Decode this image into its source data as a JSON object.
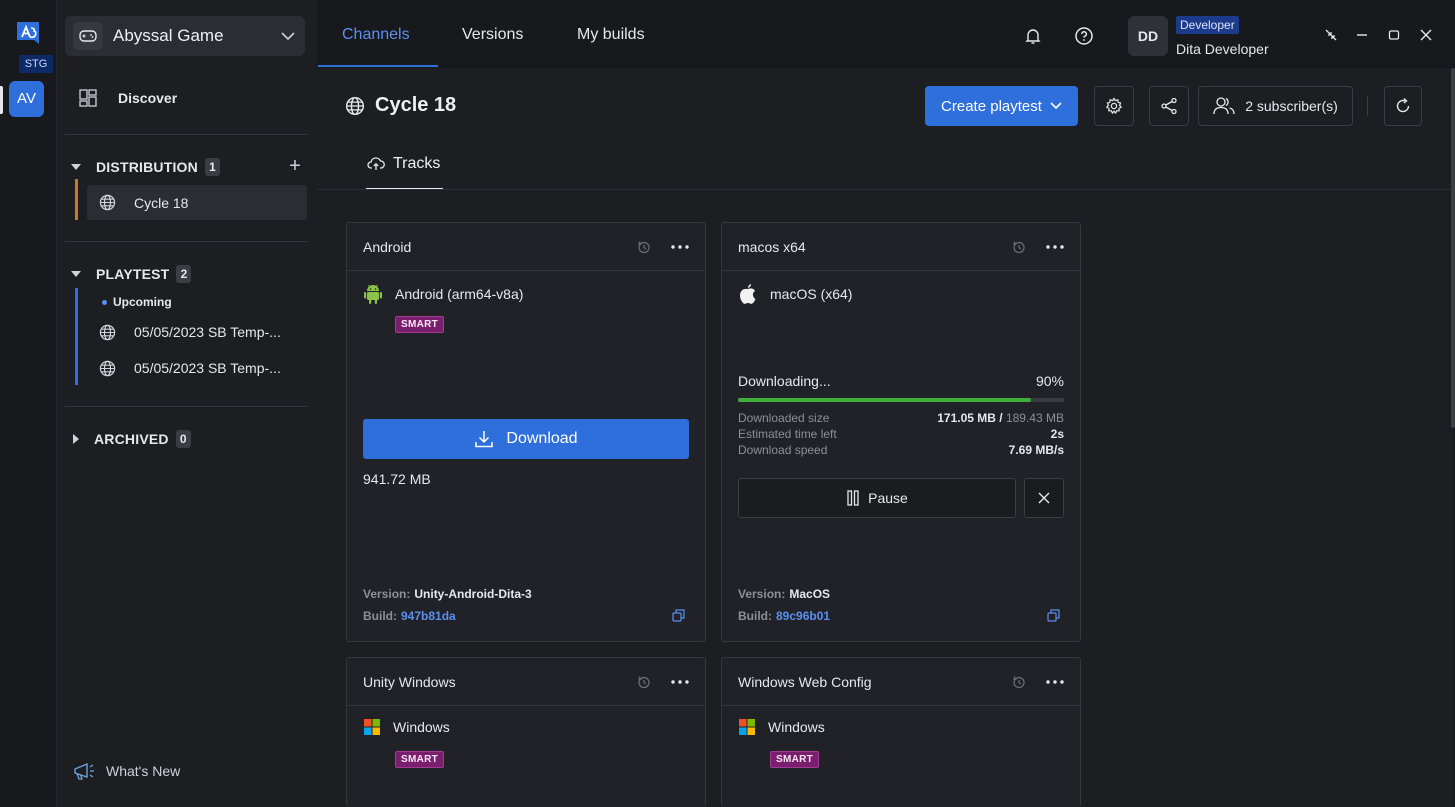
{
  "rail": {
    "env_badge": "STG",
    "avatar_initials": "AV"
  },
  "sidebar": {
    "game_name": "Abyssal Game",
    "discover_label": "Discover",
    "distribution": {
      "label": "DISTRIBUTION",
      "count": "1",
      "items": [
        {
          "label": "Cycle 18"
        }
      ]
    },
    "playtest": {
      "label": "PLAYTEST",
      "count": "2",
      "group_label": "Upcoming",
      "items": [
        {
          "label": "05/05/2023 SB Temp-..."
        },
        {
          "label": "05/05/2023 SB Temp-..."
        }
      ]
    },
    "archived": {
      "label": "ARCHIVED",
      "count": "0"
    },
    "whats_new_label": "What's New"
  },
  "topbar": {
    "tabs": [
      {
        "label": "Channels",
        "active": true
      },
      {
        "label": "Versions"
      },
      {
        "label": "My builds"
      }
    ],
    "user": {
      "initials": "DD",
      "role": "Developer",
      "name": "Dita Developer"
    }
  },
  "main": {
    "title": "Cycle 18",
    "create_playtest_label": "Create playtest",
    "subscribers_label": "2 subscriber(s)",
    "subtab_label": "Tracks",
    "cards": [
      {
        "title": "Android",
        "platform": "Android (arm64-v8a)",
        "badge": "SMART",
        "download_label": "Download",
        "size": "941.72 MB",
        "version_label": "Version:",
        "version": "Unity-Android-Dita-3",
        "build_label": "Build:",
        "build": "947b81da"
      },
      {
        "title": "macos x64",
        "platform": "macOS (x64)",
        "status": "Downloading...",
        "percent_label": "90%",
        "progress": 0.9,
        "downloaded_size_label": "Downloaded size",
        "downloaded_size_value": "171.05 MB /",
        "downloaded_size_total": "189.43 MB",
        "eta_label": "Estimated time left",
        "eta_value": "2s",
        "speed_label": "Download speed",
        "speed_value": "7.69 MB/s",
        "pause_label": "Pause",
        "version_label": "Version:",
        "version": "MacOS",
        "build_label": "Build:",
        "build": "89c96b01"
      },
      {
        "title": "Unity Windows",
        "platform": "Windows",
        "badge": "SMART"
      },
      {
        "title": "Windows Web Config",
        "platform": "Windows",
        "badge": "SMART"
      }
    ]
  },
  "colors": {
    "accent": "#2f6fdb",
    "smart_badge": "#7a1f6e",
    "progress": "#3fae3a",
    "distribution_bar": "#c87a2a"
  }
}
